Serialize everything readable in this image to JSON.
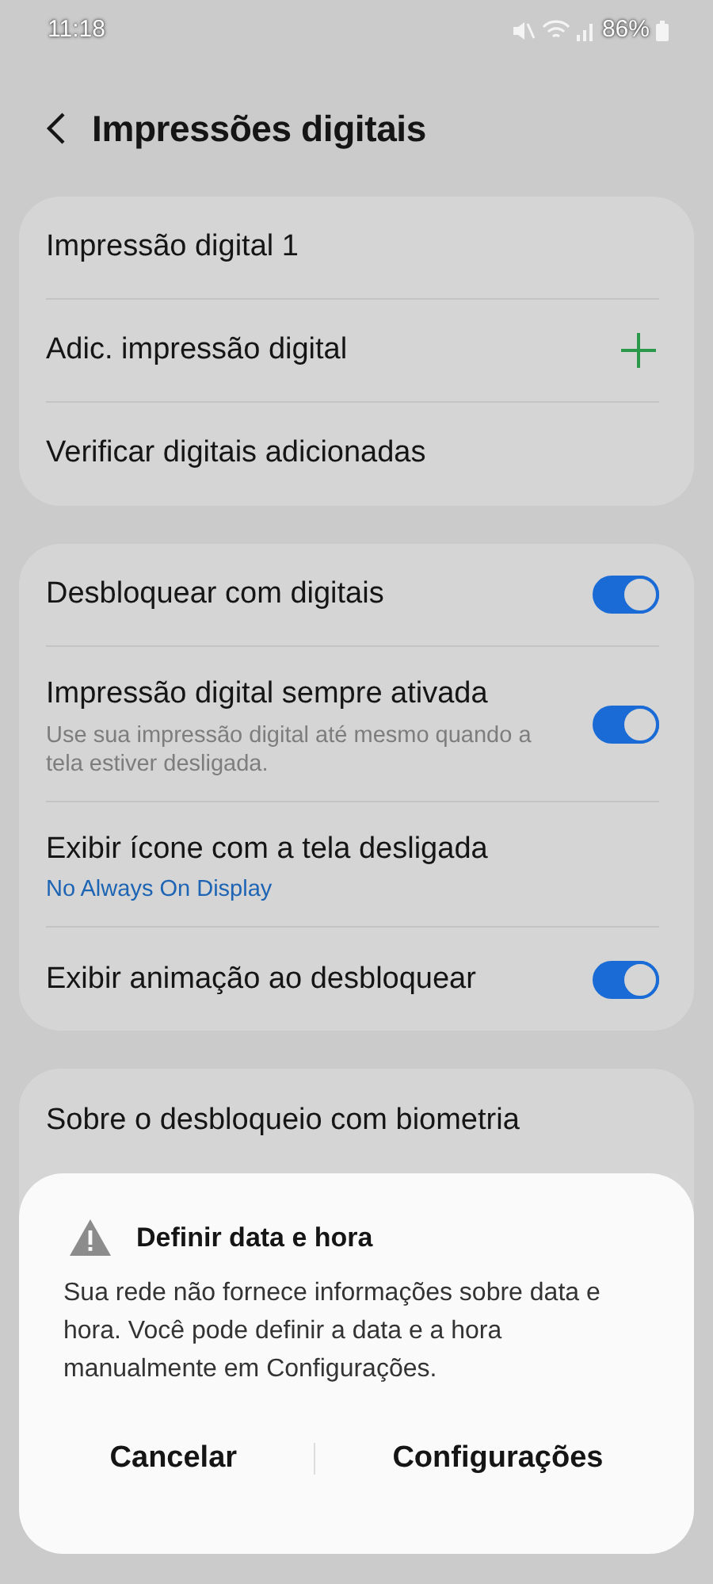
{
  "status_bar": {
    "time": "11:18",
    "battery": "86%"
  },
  "header": {
    "title": "Impressões digitais"
  },
  "groups": [
    {
      "items": [
        {
          "kind": "plain",
          "label": "Impressão digital 1"
        },
        {
          "kind": "add",
          "label": "Adic. impressão digital"
        },
        {
          "kind": "plain",
          "label": "Verificar digitais adicionadas"
        }
      ]
    },
    {
      "items": [
        {
          "kind": "toggle",
          "label": "Desbloquear com digitais",
          "on": true
        },
        {
          "kind": "toggle",
          "label": "Impressão digital sempre ativada",
          "subtitle": "Use sua impressão digital até mesmo quando a tela estiver desligada.",
          "on": true
        },
        {
          "kind": "link",
          "label": "Exibir ícone com a tela desligada",
          "subtitle": "No Always On Display"
        },
        {
          "kind": "toggle",
          "label": "Exibir animação ao desbloquear",
          "on": true
        }
      ]
    },
    {
      "items": [
        {
          "kind": "plain",
          "label": "Sobre o desbloqueio com biometria"
        }
      ]
    }
  ],
  "dialog": {
    "title": "Definir data e hora",
    "message": "Sua rede não fornece informações sobre data e hora. Você pode definir a data e a hora manualmente em Configurações.",
    "buttons": [
      "Cancelar",
      "Configurações"
    ]
  }
}
